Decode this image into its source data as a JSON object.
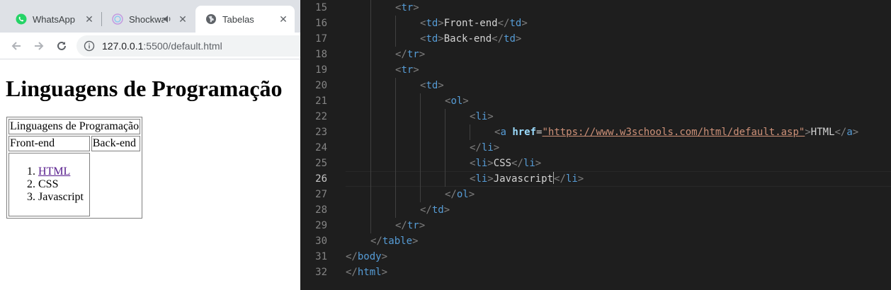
{
  "browser": {
    "tabs": [
      {
        "title": "WhatsApp",
        "icon": "whatsapp-icon",
        "active": false
      },
      {
        "title": "Shockwave",
        "icon": "shockwave-icon",
        "active": false,
        "audio": "speaker-icon"
      },
      {
        "title": "Tabelas",
        "icon": "globe-icon",
        "active": true
      }
    ],
    "url_host": "127.0.0.1",
    "url_rest": ":5500/default.html",
    "page": {
      "heading": "Linguagens de Programação",
      "table": {
        "header": "Linguagens de Programação",
        "col1": "Front-end",
        "col2": "Back-end",
        "list": [
          "HTML",
          "CSS",
          "Javascript"
        ]
      }
    }
  },
  "editor": {
    "active_line": 26,
    "lines": [
      {
        "n": 15,
        "indent": 2,
        "tokens": [
          [
            "br",
            "<"
          ],
          [
            "tag",
            "tr"
          ],
          [
            "br",
            ">"
          ]
        ]
      },
      {
        "n": 16,
        "indent": 3,
        "tokens": [
          [
            "br",
            "<"
          ],
          [
            "tag",
            "td"
          ],
          [
            "br",
            ">"
          ],
          [
            "txt",
            "Front-end"
          ],
          [
            "br",
            "</"
          ],
          [
            "tag",
            "td"
          ],
          [
            "br",
            ">"
          ]
        ]
      },
      {
        "n": 17,
        "indent": 3,
        "tokens": [
          [
            "br",
            "<"
          ],
          [
            "tag",
            "td"
          ],
          [
            "br",
            ">"
          ],
          [
            "txt",
            "Back-end"
          ],
          [
            "br",
            "</"
          ],
          [
            "tag",
            "td"
          ],
          [
            "br",
            ">"
          ]
        ]
      },
      {
        "n": 18,
        "indent": 2,
        "tokens": [
          [
            "br",
            "</"
          ],
          [
            "tag",
            "tr"
          ],
          [
            "br",
            ">"
          ]
        ]
      },
      {
        "n": 19,
        "indent": 2,
        "tokens": [
          [
            "br",
            "<"
          ],
          [
            "tag",
            "tr"
          ],
          [
            "br",
            ">"
          ]
        ]
      },
      {
        "n": 20,
        "indent": 3,
        "tokens": [
          [
            "br",
            "<"
          ],
          [
            "tag",
            "td"
          ],
          [
            "br",
            ">"
          ]
        ]
      },
      {
        "n": 21,
        "indent": 4,
        "tokens": [
          [
            "br",
            "<"
          ],
          [
            "tag",
            "ol"
          ],
          [
            "br",
            ">"
          ]
        ]
      },
      {
        "n": 22,
        "indent": 5,
        "tokens": [
          [
            "br",
            "<"
          ],
          [
            "tag",
            "li"
          ],
          [
            "br",
            ">"
          ]
        ]
      },
      {
        "n": 23,
        "indent": 6,
        "tokens": [
          [
            "br",
            "<"
          ],
          [
            "tag",
            "a"
          ],
          [
            "txt",
            " "
          ],
          [
            "attr",
            "href"
          ],
          [
            "eq",
            "="
          ],
          [
            "str",
            "\"https://www.w3schools.com/html/default.asp\""
          ],
          [
            "br",
            ">"
          ],
          [
            "txt",
            "HTML"
          ],
          [
            "br",
            "</"
          ],
          [
            "tag",
            "a"
          ],
          [
            "br",
            ">"
          ]
        ]
      },
      {
        "n": 24,
        "indent": 5,
        "tokens": [
          [
            "br",
            "</"
          ],
          [
            "tag",
            "li"
          ],
          [
            "br",
            ">"
          ]
        ]
      },
      {
        "n": 25,
        "indent": 5,
        "tokens": [
          [
            "br",
            "<"
          ],
          [
            "tag",
            "li"
          ],
          [
            "br",
            ">"
          ],
          [
            "txt",
            "CSS"
          ],
          [
            "br",
            "</"
          ],
          [
            "tag",
            "li"
          ],
          [
            "br",
            ">"
          ]
        ]
      },
      {
        "n": 26,
        "indent": 5,
        "tokens": [
          [
            "br",
            "<"
          ],
          [
            "tag",
            "li"
          ],
          [
            "br",
            ">"
          ],
          [
            "txt",
            "Javascript"
          ],
          [
            "caret",
            ""
          ],
          [
            "br",
            "</"
          ],
          [
            "tag",
            "li"
          ],
          [
            "br",
            ">"
          ]
        ]
      },
      {
        "n": 27,
        "indent": 4,
        "tokens": [
          [
            "br",
            "</"
          ],
          [
            "tag",
            "ol"
          ],
          [
            "br",
            ">"
          ]
        ]
      },
      {
        "n": 28,
        "indent": 3,
        "tokens": [
          [
            "br",
            "</"
          ],
          [
            "tag",
            "td"
          ],
          [
            "br",
            ">"
          ]
        ]
      },
      {
        "n": 29,
        "indent": 2,
        "tokens": [
          [
            "br",
            "</"
          ],
          [
            "tag",
            "tr"
          ],
          [
            "br",
            ">"
          ]
        ]
      },
      {
        "n": 30,
        "indent": 1,
        "tokens": [
          [
            "br",
            "</"
          ],
          [
            "tag",
            "table"
          ],
          [
            "br",
            ">"
          ]
        ]
      },
      {
        "n": 31,
        "indent": 0,
        "tokens": [
          [
            "br",
            "</"
          ],
          [
            "tag",
            "body"
          ],
          [
            "br",
            ">"
          ]
        ]
      },
      {
        "n": 32,
        "indent": 0,
        "tokens": [
          [
            "br",
            "</"
          ],
          [
            "tag",
            "html"
          ],
          [
            "br",
            ">"
          ]
        ]
      }
    ]
  }
}
